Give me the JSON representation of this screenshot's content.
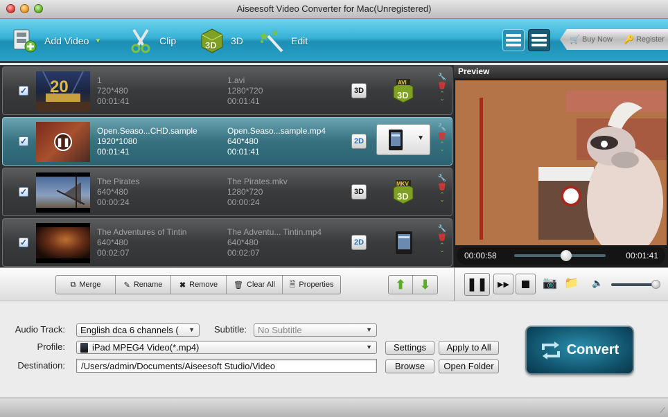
{
  "window": {
    "title": "Aiseesoft Video Converter for Mac(Unregistered)"
  },
  "toolbar": {
    "add_video": "Add Video",
    "clip": "Clip",
    "three_d": "3D",
    "edit": "Edit",
    "buy_now": "Buy Now",
    "register": "Register"
  },
  "files": [
    {
      "name": "1",
      "resolution": "720*480",
      "duration": "00:01:41",
      "out_name": "1.avi",
      "out_resolution": "1280*720",
      "out_duration": "00:01:41",
      "mode": "3D",
      "format": "AVI 3D",
      "checked": true,
      "selected": false
    },
    {
      "name": "Open.Seaso...CHD.sample",
      "resolution": "1920*1080",
      "duration": "00:01:41",
      "out_name": "Open.Seaso...sample.mp4",
      "out_resolution": "640*480",
      "out_duration": "00:01:41",
      "mode": "2D",
      "format": "iPad",
      "checked": true,
      "selected": true
    },
    {
      "name": "The Pirates",
      "resolution": "640*480",
      "duration": "00:00:24",
      "out_name": "The Pirates.mkv",
      "out_resolution": "1280*720",
      "out_duration": "00:00:24",
      "mode": "3D",
      "format": "MKV 3D",
      "checked": true,
      "selected": false
    },
    {
      "name": "The Adventures of Tintin",
      "resolution": "640*480",
      "duration": "00:02:07",
      "out_name": "The Adventu... Tintin.mp4",
      "out_resolution": "640*480",
      "out_duration": "00:02:07",
      "mode": "2D",
      "format": "iPad",
      "checked": true,
      "selected": false
    }
  ],
  "format_labels": {
    "avi": "AVI",
    "mkv": "MKV",
    "threed": "3D"
  },
  "list_actions": {
    "merge": "Merge",
    "rename": "Rename",
    "remove": "Remove",
    "clear_all": "Clear All",
    "properties": "Properties"
  },
  "preview": {
    "title": "Preview",
    "current_time": "00:00:58",
    "total_time": "00:01:41",
    "progress": 0.57,
    "volume": 1.0
  },
  "settings": {
    "audio_track_label": "Audio Track:",
    "audio_track_value": "English dca 6 channels (",
    "subtitle_label": "Subtitle:",
    "subtitle_value": "No Subtitle",
    "profile_label": "Profile:",
    "profile_value": "iPad MPEG4 Video(*.mp4)",
    "destination_label": "Destination:",
    "destination_value": "/Users/admin/Documents/Aiseesoft Studio/Video",
    "settings_btn": "Settings",
    "apply_all_btn": "Apply to All",
    "browse_btn": "Browse",
    "open_folder_btn": "Open Folder",
    "convert_btn": "Convert"
  },
  "colors": {
    "toolbar_accent": "#37b2d6",
    "selected_row": "#37707f",
    "convert_bg": "#0f4e66"
  }
}
